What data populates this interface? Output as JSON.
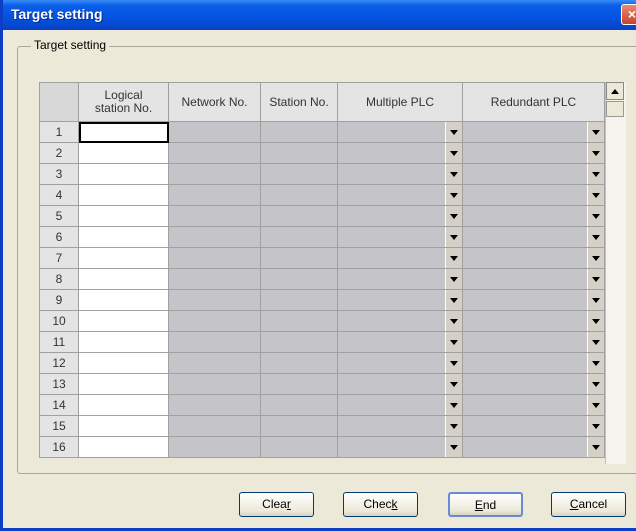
{
  "window": {
    "title": "Target setting",
    "close_label": "×"
  },
  "group": {
    "label": "Target setting"
  },
  "grid": {
    "columns": [
      {
        "line1": "Logical",
        "line2": "station No."
      },
      {
        "line1": "Network No.",
        "line2": ""
      },
      {
        "line1": "Station No.",
        "line2": ""
      },
      {
        "line1": "Multiple PLC",
        "line2": ""
      },
      {
        "line1": "Redundant PLC",
        "line2": ""
      }
    ],
    "rows": [
      "1",
      "2",
      "3",
      "4",
      "5",
      "6",
      "7",
      "8",
      "9",
      "10",
      "11",
      "12",
      "13",
      "14",
      "15",
      "16"
    ]
  },
  "buttons": {
    "clear": {
      "pre": "Clea",
      "accel": "r",
      "post": ""
    },
    "check": {
      "pre": "Chec",
      "accel": "k",
      "post": ""
    },
    "end": {
      "pre": "",
      "accel": "E",
      "post": "nd"
    },
    "cancel": {
      "pre": "",
      "accel": "C",
      "post": "ancel"
    }
  },
  "colors": {
    "titlebar": "#0553e0",
    "dialog_bg": "#ece9d8",
    "disabled_cell": "#c4c4c9"
  }
}
